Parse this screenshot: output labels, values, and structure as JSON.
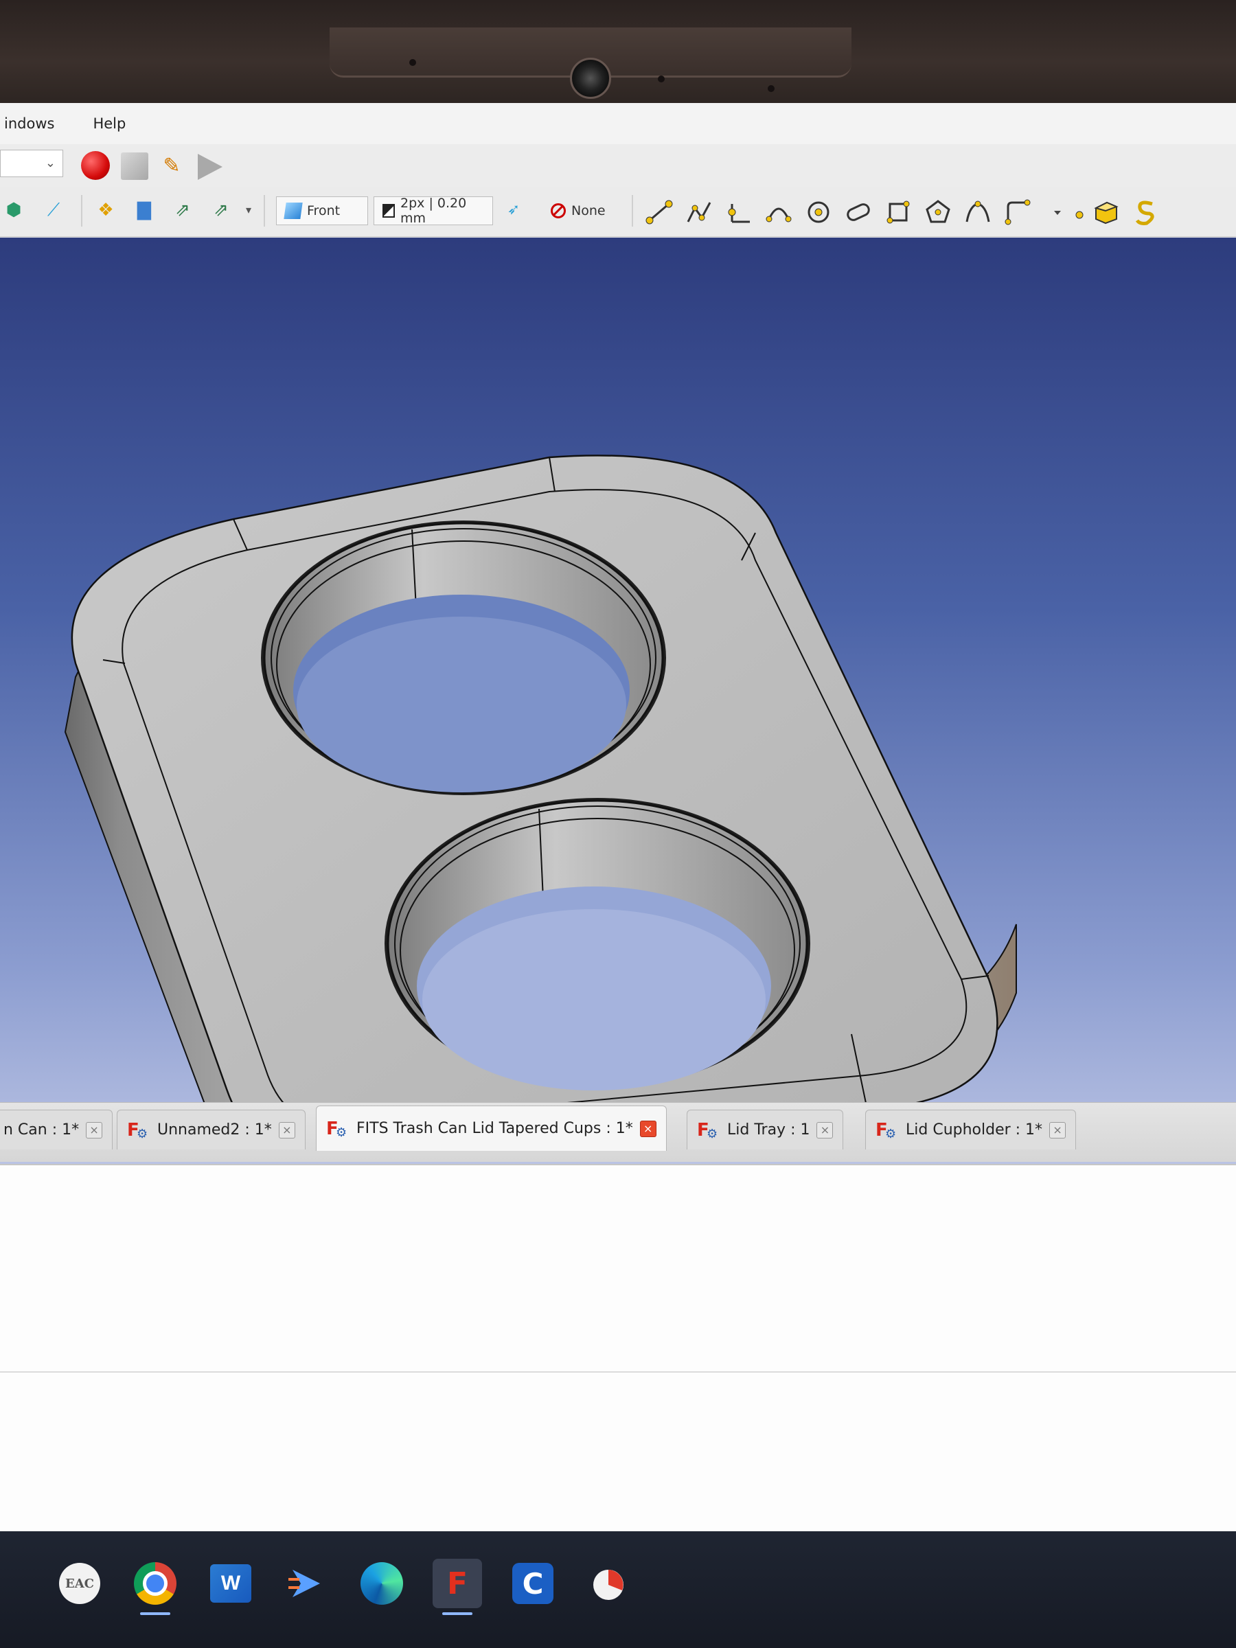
{
  "menubar": {
    "items": [
      "indows",
      "Help"
    ]
  },
  "toolbar": {
    "view_label": "Front",
    "line_width_label": "2px | 0.20 mm",
    "none_label": "None"
  },
  "tabs": [
    {
      "label": "n Can : 1*",
      "active": false
    },
    {
      "label": "Unnamed2 : 1*",
      "active": false
    },
    {
      "label": "FITS Trash Can Lid Tapered Cups : 1*",
      "active": true
    },
    {
      "label": "Lid Tray : 1",
      "active": false
    },
    {
      "label": "Lid Cupholder : 1*",
      "active": false
    }
  ],
  "tab_logo_letter": "F",
  "taskbar": {
    "apps": [
      "EAC",
      "W",
      "C"
    ]
  },
  "icons": {
    "close": "×",
    "dropdown": "⌄",
    "gear": "⚙"
  },
  "colors": {
    "viewport_top": "#2d3c7d",
    "viewport_bottom": "#c6cde9",
    "record": "#d40b0b",
    "active_close": "#e8492b",
    "freecad_red": "#d8261b"
  }
}
